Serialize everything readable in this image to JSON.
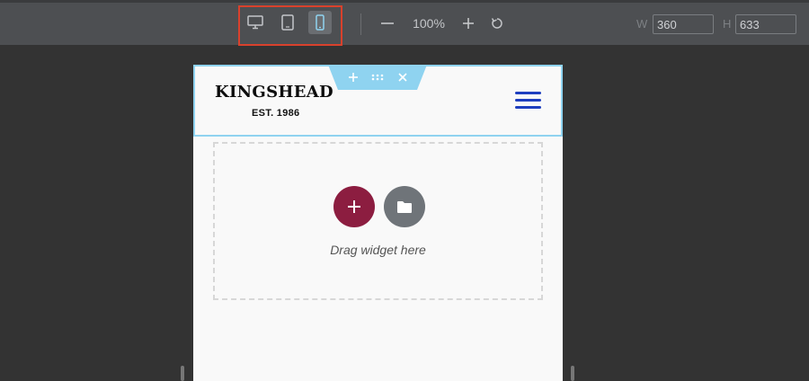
{
  "toolbar": {
    "devices": [
      {
        "name": "desktop",
        "icon": "desktop-icon",
        "active": false
      },
      {
        "name": "tablet",
        "icon": "tablet-icon",
        "active": false
      },
      {
        "name": "mobile",
        "icon": "mobile-icon",
        "active": true
      }
    ],
    "zoom": "100%",
    "width_label": "W",
    "width_value": "360",
    "height_label": "H",
    "height_value": "633",
    "highlight_color": "#d9412c"
  },
  "preview": {
    "logo_title": "KINGSHEAD",
    "logo_subtitle": "EST. 1986",
    "drop_zone_text": "Drag widget here",
    "add_button_color": "#8c1d40",
    "template_button_color": "#6f7479",
    "section_handle_color": "#8fd3f0",
    "menu_icon_color": "#1e3fbf"
  }
}
